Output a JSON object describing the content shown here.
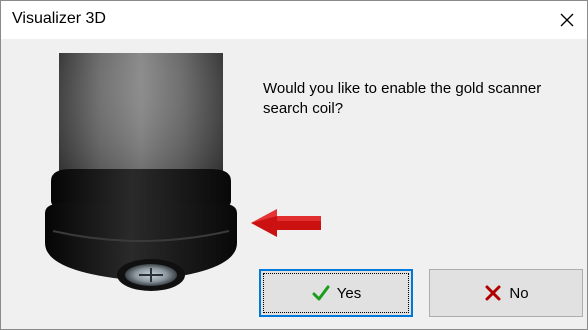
{
  "window": {
    "title": "Visualizer 3D",
    "close_icon": "close-icon"
  },
  "dialog": {
    "message": "Would you like to enable the gold scanner search coil?",
    "illustration": "search-coil-illustration",
    "pointer_icon": "red-arrow-icon"
  },
  "buttons": {
    "yes": {
      "label": "Yes",
      "icon": "check-icon",
      "icon_color": "#1a9e1a"
    },
    "no": {
      "label": "No",
      "icon": "x-icon",
      "icon_color": "#b00000"
    }
  },
  "colors": {
    "focus_border": "#0078d7",
    "arrow": "#cc1111"
  }
}
